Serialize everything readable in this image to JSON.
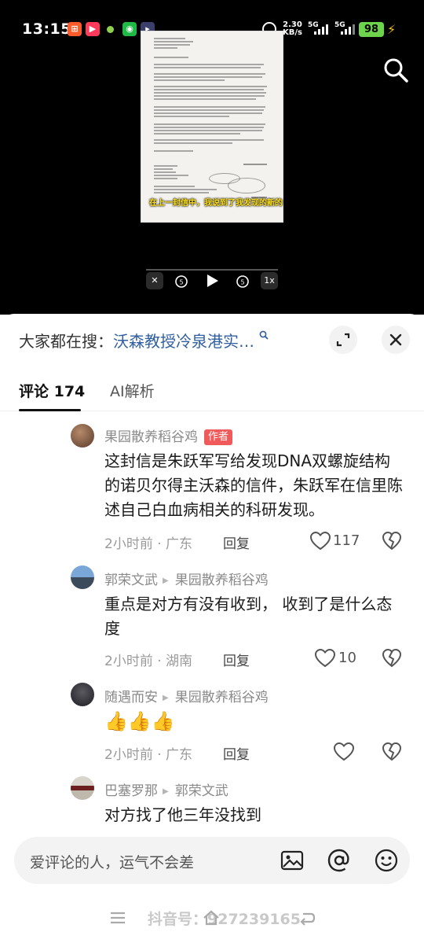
{
  "status_bar": {
    "time": "13:15",
    "speed_value": "2.30",
    "speed_unit": "KB/s",
    "net1": "5G",
    "net2": "5G",
    "battery": "98"
  },
  "video": {
    "subtitle": "在上一封信中，我说到了我发现的新的",
    "speed_label": "1x"
  },
  "panel": {
    "search_prefix": "大家都在搜：",
    "search_query": "沃森教授冷泉港实…",
    "tabs": [
      {
        "label": "评论 174"
      },
      {
        "label": "AI解析"
      }
    ]
  },
  "comments": [
    {
      "user": "果园散养稻谷鸡",
      "author_tag": "作者",
      "text": "这封信是朱跃军写给发现DNA双螺旋结构的诺贝尔得主沃森的信件，朱跃军在信里陈述自己白血病相关的科研发现。",
      "time_location": "2小时前 · 广东",
      "reply": "回复",
      "likes": "117"
    },
    {
      "user": "郭荣文武",
      "reply_to": "果园散养稻谷鸡",
      "text": "重点是对方有没有收到， 收到了是什么态度",
      "time_location": "2小时前 · 湖南",
      "reply": "回复",
      "likes": "10"
    },
    {
      "user": "随遇而安",
      "reply_to": "果园散养稻谷鸡",
      "text": "👍👍👍",
      "time_location": "2小时前 · 广东",
      "reply": "回复",
      "likes": ""
    },
    {
      "user": "巴塞罗那",
      "reply_to": "郭荣文武",
      "text": "对方找了他三年没找到"
    }
  ],
  "composer": {
    "placeholder": "爱评论的人，运气不会差"
  },
  "watermark": "抖音号：927239165",
  "colors": {
    "accent_link": "#2f5fa0",
    "author_tag": "#f05a5a",
    "battery": "#6dd34a"
  }
}
